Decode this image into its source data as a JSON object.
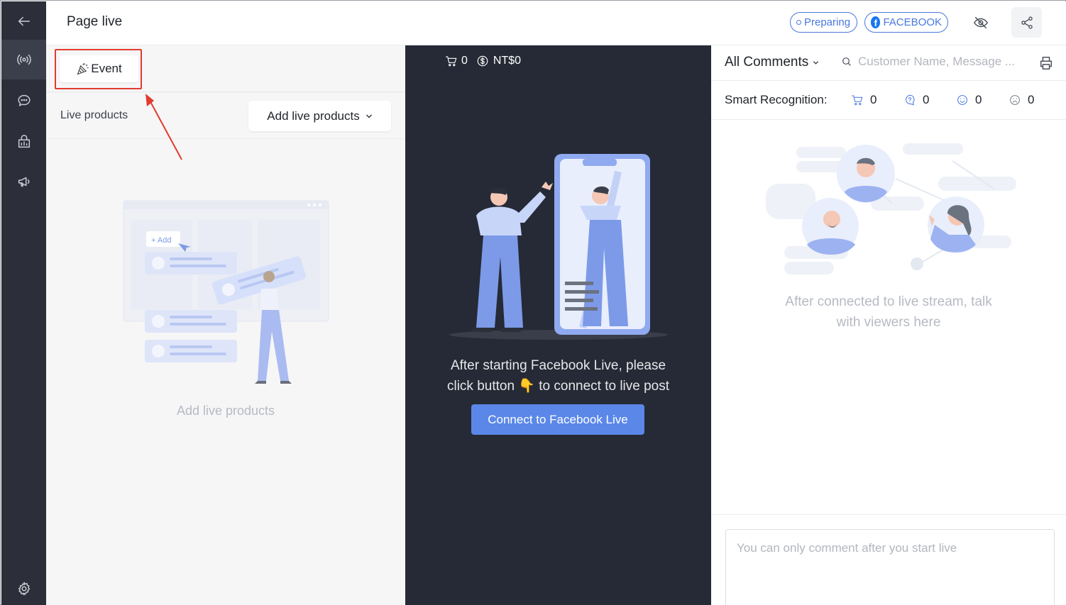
{
  "header": {
    "title": "Page live",
    "status_pill": "Preparing",
    "platform_pill": "FACEBOOK",
    "fb_glyph": "f",
    "icons": [
      "back-arrow-icon",
      "eye-off-icon",
      "share-icon"
    ]
  },
  "sidebar": {
    "items": [
      "back",
      "live-broadcast",
      "chat",
      "shop-stats",
      "megaphone",
      "settings"
    ]
  },
  "left_panel": {
    "event_button": "Event",
    "live_products_label": "Live products",
    "add_live_products_button": "Add live products",
    "illustration_add_label": "+ Add",
    "empty_state_text": "Add live products"
  },
  "center_panel": {
    "cart_count": "0",
    "amount": "NT$0",
    "message_line1": "After starting Facebook Live, please",
    "message_line2_before": "click button",
    "message_emoji": "👇",
    "message_line2_after": "to connect to live post",
    "connect_button": "Connect to Facebook Live"
  },
  "right_panel": {
    "filter_label": "All Comments",
    "search_placeholder": "Customer Name, Message ...",
    "smart_recognition_label": "Smart Recognition:",
    "smart_counts": {
      "cart": "0",
      "question": "0",
      "happy": "0",
      "sad": "0"
    },
    "empty_line1": "After connected to live stream, talk",
    "empty_line2": "with viewers here",
    "comment_placeholder": "You can only comment after you start live"
  },
  "colors": {
    "accent": "#4a78de",
    "sidebar_bg": "#2c2f3a",
    "center_bg": "#262a36",
    "connect_button": "#5a87e8",
    "highlight": "#e23b2e"
  }
}
